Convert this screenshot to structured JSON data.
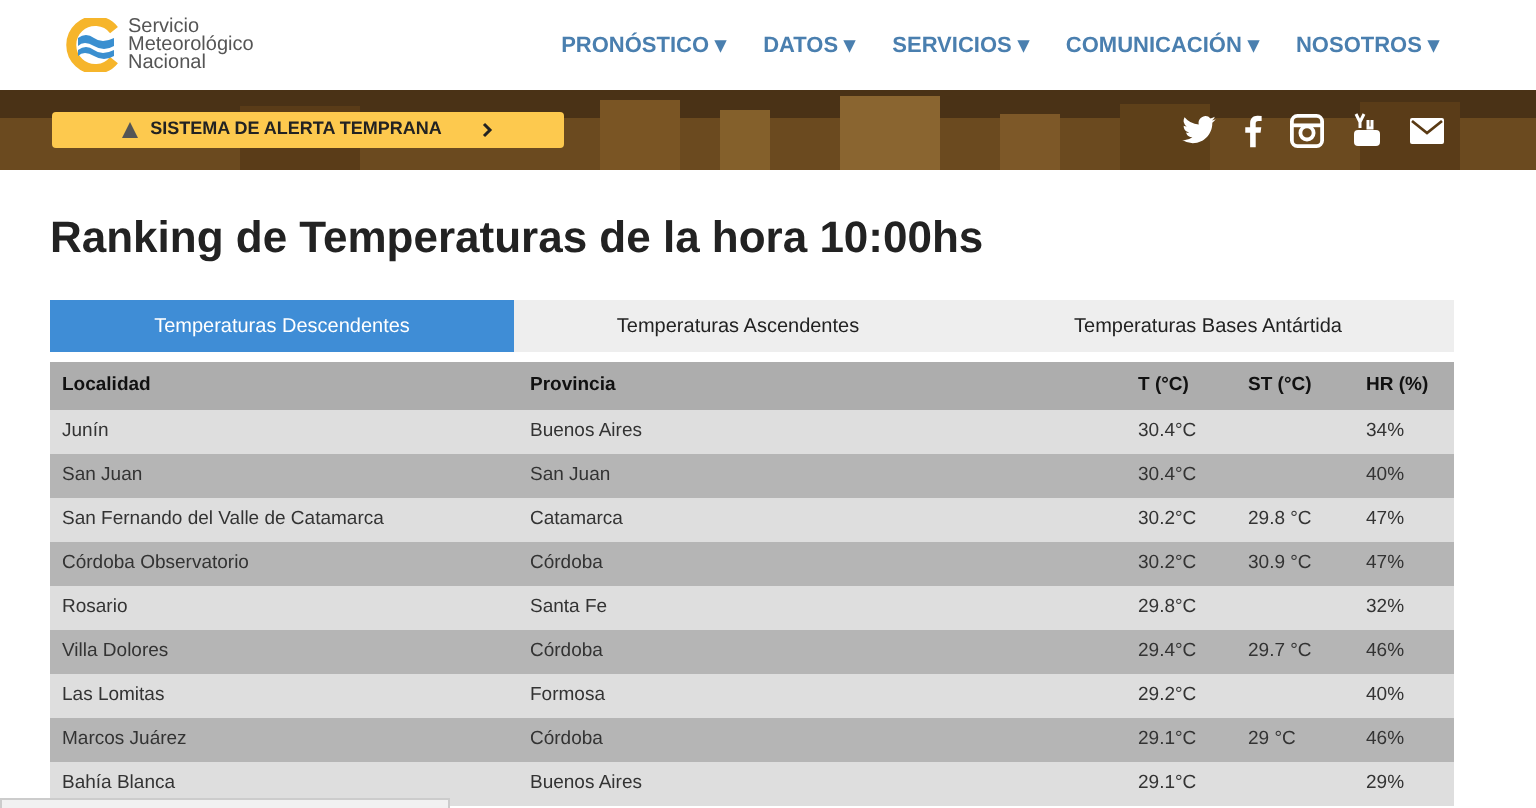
{
  "header": {
    "logo_text": [
      "Servicio",
      "Meteorológico",
      "Nacional"
    ],
    "nav": [
      {
        "label": "PRONÓSTICO",
        "caret": "▾"
      },
      {
        "label": "DATOS",
        "caret": "▾"
      },
      {
        "label": "SERVICIOS",
        "caret": "▾"
      },
      {
        "label": "COMUNICACIÓN",
        "caret": "▾"
      },
      {
        "label": "NOSOTROS",
        "caret": "▾"
      }
    ]
  },
  "banner": {
    "alert_button": "SISTEMA DE ALERTA TEMPRANA"
  },
  "title": "Ranking de Temperaturas de la hora 10:00hs",
  "tabs": [
    {
      "label": "Temperaturas Descendentes",
      "selected": true
    },
    {
      "label": "Temperaturas Ascendentes",
      "selected": false
    },
    {
      "label": "Temperaturas Bases Antártida",
      "selected": false
    }
  ],
  "table": {
    "columns": [
      "Localidad",
      "Provincia",
      "T (°C)",
      "ST (°C)",
      "HR (%)"
    ],
    "rows": [
      [
        "Junín",
        "Buenos Aires",
        "30.4°C",
        "",
        "34%"
      ],
      [
        "San Juan",
        "San Juan",
        "30.4°C",
        "",
        "40%"
      ],
      [
        "San Fernando del Valle de Catamarca",
        "Catamarca",
        "30.2°C",
        "29.8 °C",
        "47%"
      ],
      [
        "Córdoba Observatorio",
        "Córdoba",
        "30.2°C",
        "30.9 °C",
        "47%"
      ],
      [
        "Rosario",
        "Santa Fe",
        "29.8°C",
        "",
        "32%"
      ],
      [
        "Villa Dolores",
        "Córdoba",
        "29.4°C",
        "29.7 °C",
        "46%"
      ],
      [
        "Las Lomitas",
        "Formosa",
        "29.2°C",
        "",
        "40%"
      ],
      [
        "Marcos Juárez",
        "Córdoba",
        "29.1°C",
        "29 °C",
        "46%"
      ],
      [
        "Bahía Blanca",
        "Buenos Aires",
        "29.1°C",
        "",
        "29%"
      ]
    ]
  }
}
